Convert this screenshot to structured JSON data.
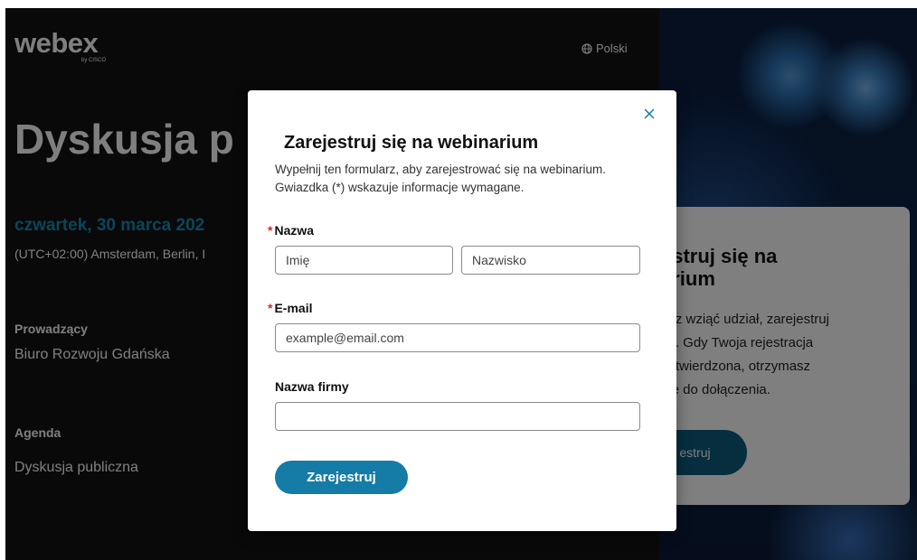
{
  "header": {
    "logo_word": "webex",
    "logo_sub": "by CISCO",
    "language": "Polski"
  },
  "event": {
    "title": "Dyskusja p",
    "date": "czwartek, 30 marca 202",
    "timezone": "(UTC+02:00) Amsterdam, Berlin, I",
    "host_label": "Prowadzący",
    "host": "Biuro Rozwoju Gdańska",
    "agenda_label": "Agenda",
    "agenda": "Dyskusja publiczna"
  },
  "side_card": {
    "title": "estruj się na\narium",
    "text": "esz wziąć udział, zarejestruj\naz. Gdy Twoja rejestracja\nzatwierdzona, otrzymasz\nnie do dołączenia.",
    "button": "estruj"
  },
  "modal": {
    "title": "Zarejestruj się na webinarium",
    "description": "Wypełnij ten formularz, aby zarejestrować się na webinarium. Gwiazdka (*) wskazuje informacje wymagane.",
    "required_mark": "*",
    "name_label": "Nazwa",
    "first_name_placeholder": "Imię",
    "last_name_placeholder": "Nazwisko",
    "email_label": "E-mail",
    "email_placeholder": "example@email.com",
    "company_label": "Nazwa firmy",
    "company_value": "",
    "submit": "Zarejestruj"
  },
  "colors": {
    "accent": "#147ca6",
    "date": "#178ab6",
    "required": "#d02b2b"
  }
}
